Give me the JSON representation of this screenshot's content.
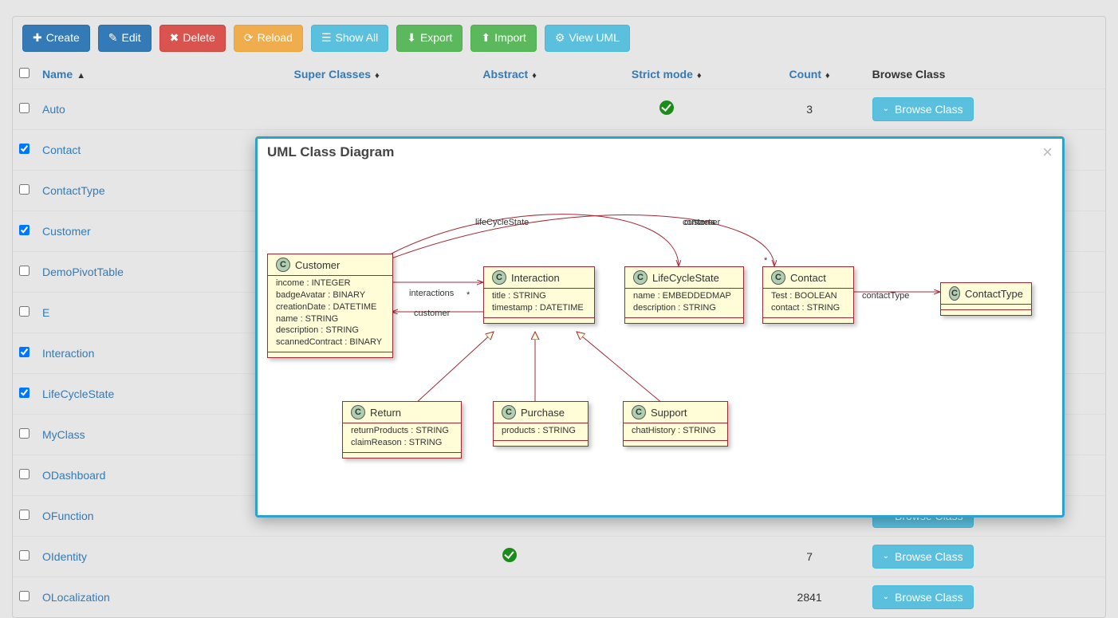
{
  "toolbar": {
    "create": "Create",
    "edit": "Edit",
    "delete": "Delete",
    "reload": "Reload",
    "show_all": "Show All",
    "export": "Export",
    "import": "Import",
    "view_uml": "View UML"
  },
  "columns": {
    "checkbox": "",
    "name": "Name",
    "super": "Super Classes",
    "abstract": "Abstract",
    "strict": "Strict mode",
    "count": "Count",
    "browse": "Browse Class"
  },
  "browse_label": "Browse Class",
  "rows": [
    {
      "name": "Auto",
      "super": "",
      "abstract": false,
      "strict": true,
      "count": "3",
      "checked": false
    },
    {
      "name": "Contact",
      "super": "",
      "abstract": false,
      "strict": false,
      "count": "",
      "checked": true
    },
    {
      "name": "ContactType",
      "super": "",
      "abstract": false,
      "strict": false,
      "count": "",
      "checked": false
    },
    {
      "name": "Customer",
      "super": "",
      "abstract": false,
      "strict": false,
      "count": "",
      "checked": true
    },
    {
      "name": "DemoPivotTable",
      "super": "",
      "abstract": false,
      "strict": false,
      "count": "",
      "checked": false
    },
    {
      "name": "E",
      "super": "",
      "abstract": false,
      "strict": false,
      "count": "",
      "checked": false
    },
    {
      "name": "Interaction",
      "super": "",
      "abstract": false,
      "strict": false,
      "count": "",
      "checked": true
    },
    {
      "name": "LifeCycleState",
      "super": "",
      "abstract": false,
      "strict": false,
      "count": "",
      "checked": true
    },
    {
      "name": "MyClass",
      "super": "",
      "abstract": false,
      "strict": false,
      "count": "",
      "checked": false
    },
    {
      "name": "ODashboard",
      "super": "",
      "abstract": false,
      "strict": false,
      "count": "",
      "checked": false
    },
    {
      "name": "OFunction",
      "super": "",
      "abstract": false,
      "strict": false,
      "count": "",
      "checked": false
    },
    {
      "name": "OIdentity",
      "super": "",
      "abstract": true,
      "strict": false,
      "count": "7",
      "checked": false
    },
    {
      "name": "OLocalization",
      "super": "",
      "abstract": false,
      "strict": false,
      "count": "2841",
      "checked": false
    }
  ],
  "modal": {
    "title": "UML Class Diagram",
    "classes": {
      "Customer": {
        "name": "Customer",
        "attrs": [
          "income : INTEGER",
          "badgeAvatar : BINARY",
          "creationDate : DATETIME",
          "name : STRING",
          "description : STRING",
          "scannedContract : BINARY"
        ]
      },
      "Interaction": {
        "name": "Interaction",
        "attrs": [
          "title : STRING",
          "timestamp : DATETIME"
        ]
      },
      "LifeCycleState": {
        "name": "LifeCycleState",
        "attrs": [
          "name : EMBEDDEDMAP",
          "description : STRING"
        ]
      },
      "Contact": {
        "name": "Contact",
        "attrs": [
          "Test : BOOLEAN",
          "contact : STRING"
        ]
      },
      "ContactType": {
        "name": "ContactType",
        "attrs": []
      },
      "Return": {
        "name": "Return",
        "attrs": [
          "returnProducts : STRING",
          "claimReason : STRING"
        ]
      },
      "Purchase": {
        "name": "Purchase",
        "attrs": [
          "products : STRING"
        ]
      },
      "Support": {
        "name": "Support",
        "attrs": [
          "chatHistory : STRING"
        ]
      }
    },
    "edge_labels": {
      "lifecycle": "lifeCycleState",
      "contacts": "contacts",
      "customer_overlap": "customer",
      "interactions": "interactions",
      "interactions_star": "*",
      "customer": "customer",
      "contact_mult": "*",
      "contactType": "contactType"
    }
  }
}
